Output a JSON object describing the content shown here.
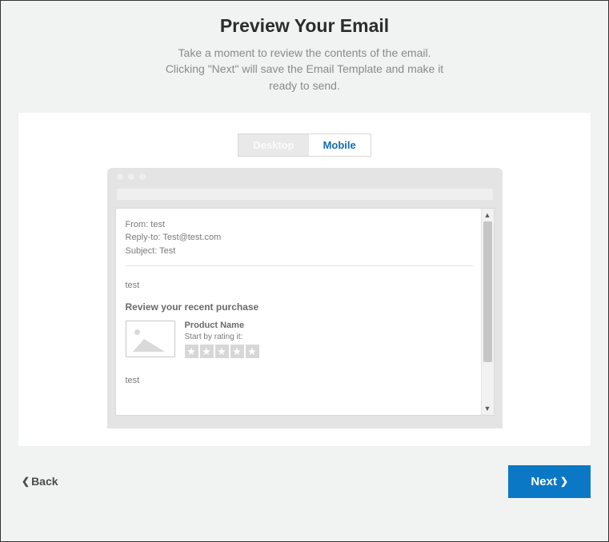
{
  "header": {
    "title": "Preview Your Email",
    "description_line1": "Take a moment to review the contents of the email.",
    "description_line2": "Clicking \"Next\" will save the Email Template and make it",
    "description_line3": "ready to send."
  },
  "tabs": {
    "desktop": "Desktop",
    "mobile": "Mobile",
    "active": "mobile"
  },
  "email": {
    "meta": {
      "from_label": "From:",
      "from_value": "test",
      "replyto_label": "Reply-to:",
      "replyto_value": "Test@test.com",
      "subject_label": "Subject:",
      "subject_value": "Test"
    },
    "body_line": "test",
    "review_title": "Review your recent purchase",
    "product": {
      "name": "Product Name",
      "subtext": "Start by rating it:",
      "star_count": 5,
      "star_glyph": "★"
    },
    "cutoff_line": "test"
  },
  "footer": {
    "back_label": "Back",
    "next_label": "Next"
  }
}
